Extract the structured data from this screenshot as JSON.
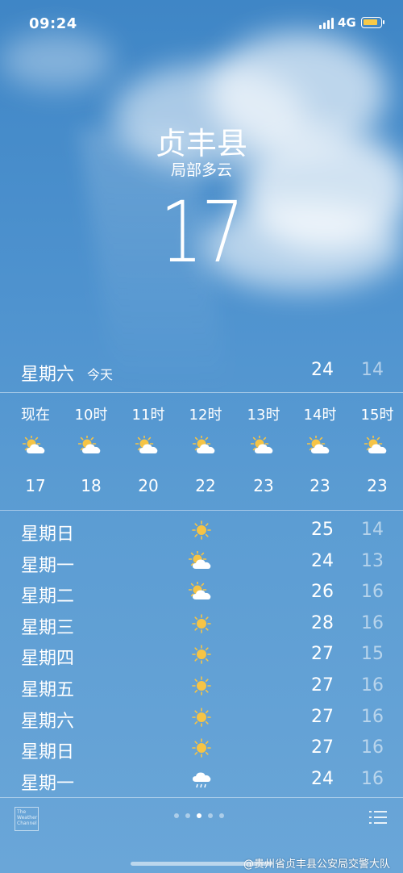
{
  "status_bar": {
    "time": "09:24",
    "network": "4G",
    "battery_color": "#f7c948"
  },
  "header": {
    "city": "贞丰县",
    "condition": "局部多云",
    "temperature": "17"
  },
  "today": {
    "day": "星期六",
    "tag": "今天",
    "high": "24",
    "low": "14"
  },
  "hourly": [
    {
      "label": "现在",
      "icon": "partly-cloudy-icon",
      "temp": "17"
    },
    {
      "label": "10时",
      "icon": "partly-cloudy-icon",
      "temp": "18"
    },
    {
      "label": "11时",
      "icon": "partly-cloudy-icon",
      "temp": "20"
    },
    {
      "label": "12时",
      "icon": "partly-cloudy-icon",
      "temp": "22"
    },
    {
      "label": "13时",
      "icon": "partly-cloudy-icon",
      "temp": "23"
    },
    {
      "label": "14时",
      "icon": "partly-cloudy-icon",
      "temp": "23"
    },
    {
      "label": "15时",
      "icon": "partly-cloudy-icon",
      "temp": "23"
    }
  ],
  "daily": [
    {
      "day": "星期日",
      "icon": "sun-icon",
      "high": "25",
      "low": "14"
    },
    {
      "day": "星期一",
      "icon": "partly-cloudy-icon",
      "high": "24",
      "low": "13"
    },
    {
      "day": "星期二",
      "icon": "partly-cloudy-icon",
      "high": "26",
      "low": "16"
    },
    {
      "day": "星期三",
      "icon": "sun-icon",
      "high": "28",
      "low": "16"
    },
    {
      "day": "星期四",
      "icon": "sun-icon",
      "high": "27",
      "low": "15"
    },
    {
      "day": "星期五",
      "icon": "sun-icon",
      "high": "27",
      "low": "16"
    },
    {
      "day": "星期六",
      "icon": "sun-icon",
      "high": "27",
      "low": "16"
    },
    {
      "day": "星期日",
      "icon": "sun-icon",
      "high": "27",
      "low": "16"
    },
    {
      "day": "星期一",
      "icon": "rain-icon",
      "high": "24",
      "low": "16"
    }
  ],
  "footer": {
    "provider_logo_text": "The Weather Channel",
    "page_count": 5,
    "active_page": 3,
    "watermark": "@贵州省贞丰县公安局交警大队"
  }
}
